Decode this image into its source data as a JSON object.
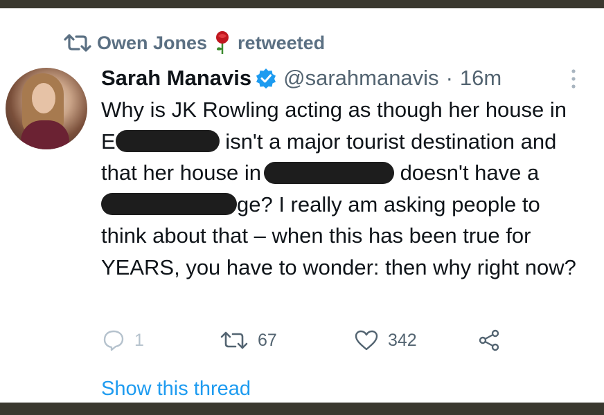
{
  "retweet_header": {
    "retweeter": "Owen Jones",
    "action": "retweeted",
    "icon": "retweet-icon",
    "emoji": "rose-emoji"
  },
  "tweet": {
    "author_name": "Sarah Manavis",
    "verified": true,
    "handle": "@sarahmanavis",
    "separator": "·",
    "time": "16m",
    "text_segments": [
      "Why is JK Rowling acting as though her house in ",
      " isn't a major tourist destination and that her house in",
      " doesn't have a ",
      "ge? I really am asking people to think about that – when this has been true for YEARS, you have to wonder: then why right now?"
    ],
    "text_prefix_visible": "E"
  },
  "actions": {
    "reply_count": "1",
    "retweet_count": "67",
    "like_count": "342"
  },
  "footer": {
    "show_thread": "Show this thread"
  },
  "colors": {
    "accent": "#1d9bf0",
    "muted": "#536471",
    "text": "#0f1419",
    "border": "#3a382f",
    "redaction": "#1d1d1d"
  }
}
